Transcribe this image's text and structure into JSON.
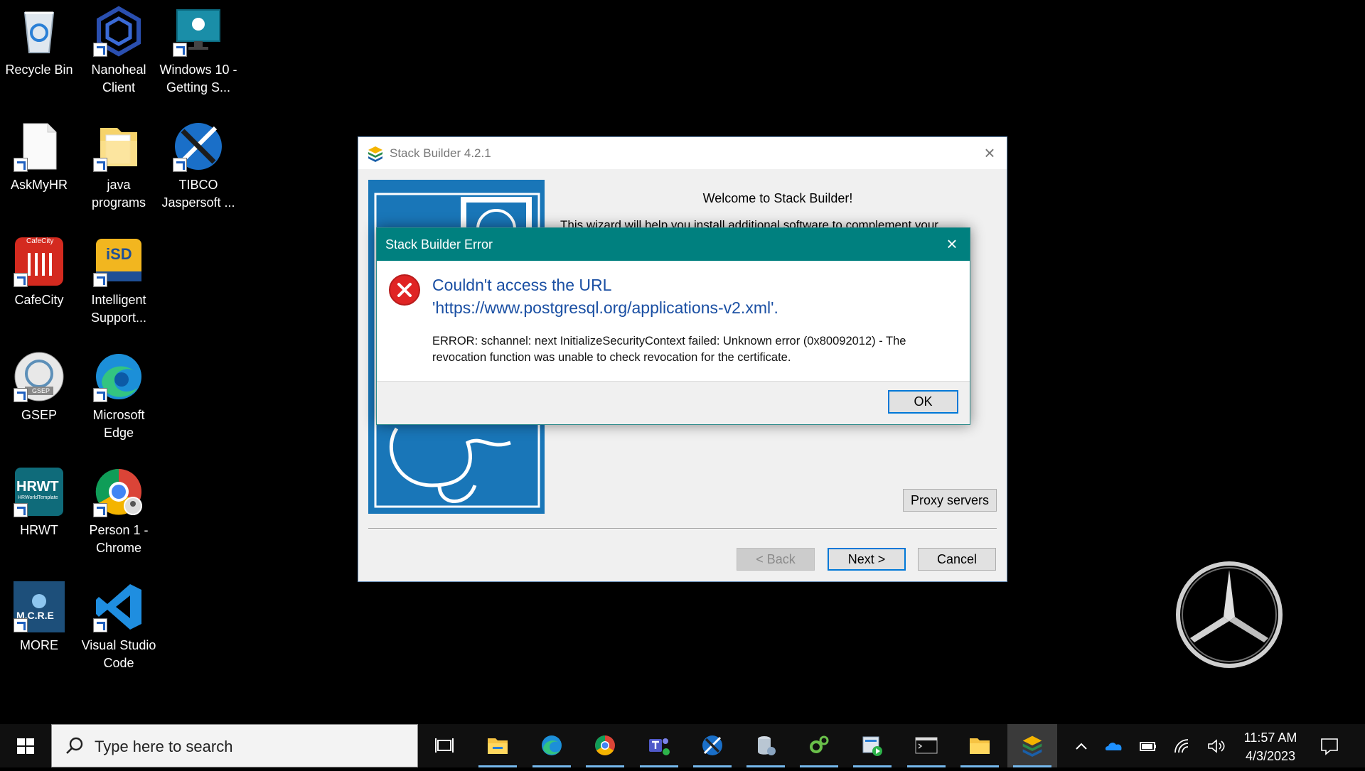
{
  "desktop": {
    "icons": [
      {
        "label": "Recycle Bin",
        "icon": "recycle-bin-icon"
      },
      {
        "label": "Nanoheal Client",
        "icon": "nanoheal-icon"
      },
      {
        "label": "Windows 10 - Getting S...",
        "icon": "windows-tips-icon"
      },
      {
        "label": "AskMyHR",
        "icon": "blank-file-icon"
      },
      {
        "label": "java programs",
        "icon": "folder-icon"
      },
      {
        "label": "TIBCO Jaspersoft ...",
        "icon": "jaspersoft-icon"
      },
      {
        "label": "CafeCity",
        "icon": "cafecity-icon"
      },
      {
        "label": "Intelligent Support...",
        "icon": "isd-icon"
      },
      {
        "label": "GSEP",
        "icon": "gsep-icon"
      },
      {
        "label": "Microsoft Edge",
        "icon": "edge-icon"
      },
      {
        "label": "HRWT",
        "icon": "hrwt-icon"
      },
      {
        "label": "Person 1 - Chrome",
        "icon": "chrome-icon"
      },
      {
        "label": "MORE",
        "icon": "more-icon"
      },
      {
        "label": "Visual Studio Code",
        "icon": "vscode-icon"
      }
    ],
    "cafecity_badge": "CafeCity",
    "isd_badge": "iSD",
    "gsep_badge": "GSEP",
    "hrwt_badge": "HRWT",
    "hrwt_sub": "HRWorldTemplate",
    "more_badge": "M.C.R.E"
  },
  "stack_builder": {
    "title": "Stack Builder 4.2.1",
    "welcome": "Welcome to Stack Builder!",
    "description": "This wizard will help you install additional software to complement your",
    "proxy_button": "Proxy servers",
    "back_button": "< Back",
    "next_button": "Next >",
    "cancel_button": "Cancel"
  },
  "error_dialog": {
    "title": "Stack Builder Error",
    "heading_line1": "Couldn't access the URL",
    "heading_line2": "'https://www.postgresql.org/applications-v2.xml'.",
    "detail_line1": "ERROR: schannel: next InitializeSecurityContext failed: Unknown error (0x80092012) - The",
    "detail_line2": "revocation function was unable to check revocation for the certificate.",
    "ok_button": "OK"
  },
  "taskbar": {
    "search_placeholder": "Type here to search",
    "apps": [
      "task-view",
      "file-explorer",
      "edge",
      "chrome",
      "teams",
      "jaspersoft",
      "database",
      "gear-app",
      "media-app",
      "terminal",
      "folder",
      "stack-builder"
    ],
    "time": "11:57 AM",
    "date": "4/3/2023"
  },
  "colors": {
    "error_titlebar": "#00807f",
    "error_heading": "#1a4fa3",
    "accent": "#0078d7"
  }
}
